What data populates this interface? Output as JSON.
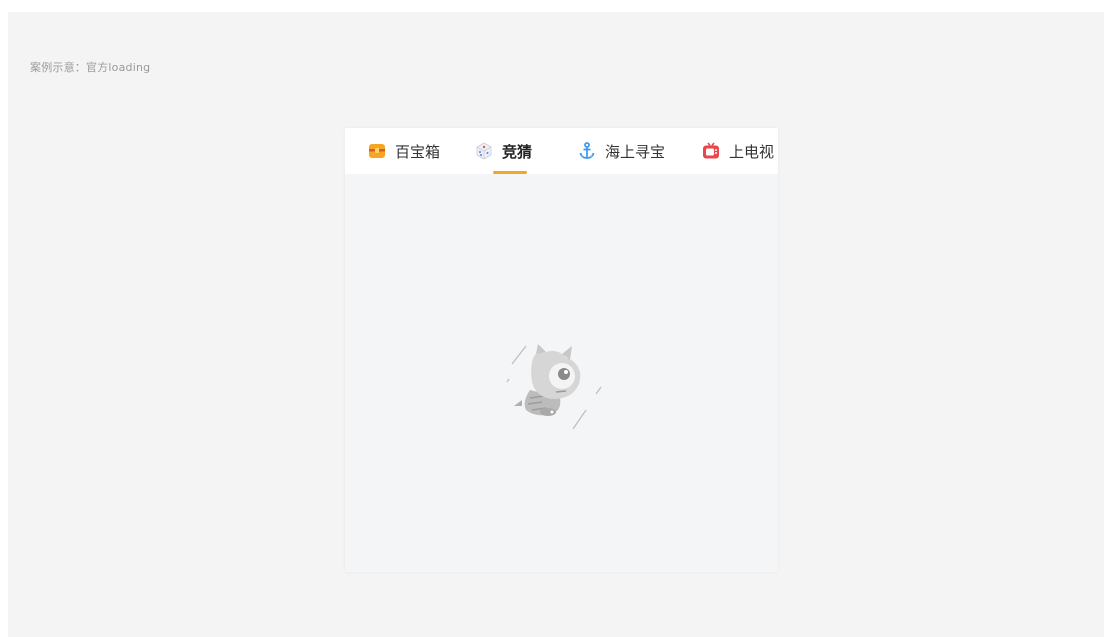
{
  "caption": "案例示意：官方loading",
  "tabs": [
    {
      "label": "百宝箱",
      "icon": "treasure-chest-icon",
      "active": false
    },
    {
      "label": "竞猜",
      "icon": "dice-icon",
      "active": true
    },
    {
      "label": "海上寻宝",
      "icon": "anchor-icon",
      "active": false
    },
    {
      "label": "上电视",
      "icon": "tv-icon",
      "active": false
    }
  ],
  "colors": {
    "accent": "#f5a623",
    "panel_background": "#f4f5f7",
    "page_background": "#f4f4f4"
  },
  "loading": {
    "icon": "loading-cat-mascot-icon"
  }
}
